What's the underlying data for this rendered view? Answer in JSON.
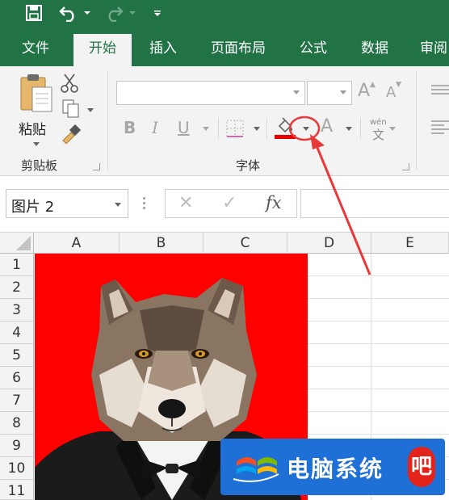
{
  "colors": {
    "brand": "#217346",
    "picture_bg": "#ff0000",
    "watermark_bg": "#1e6fd6",
    "annotation": "#e8393a"
  },
  "quick_access": {
    "icons": [
      "save-icon",
      "undo-icon",
      "undo-dropdown-icon",
      "redo-icon",
      "redo-dropdown-icon",
      "customize-qat-icon"
    ]
  },
  "tabs": [
    {
      "label": "文件"
    },
    {
      "label": "开始",
      "active": true
    },
    {
      "label": "插入"
    },
    {
      "label": "页面布局"
    },
    {
      "label": "公式"
    },
    {
      "label": "数据"
    },
    {
      "label": "审阅"
    }
  ],
  "ribbon": {
    "clipboard": {
      "paste_label": "粘贴",
      "group_label": "剪贴板",
      "icons": [
        "paste-icon",
        "cut-icon",
        "copy-icon",
        "format-painter-icon"
      ]
    },
    "font": {
      "group_label": "字体",
      "font_name_value": "",
      "font_size_value": "",
      "grow_label": "A",
      "shrink_label": "A",
      "bold_label": "B",
      "italic_label": "I",
      "underline_label": "U",
      "font_color_label": "A",
      "phonetic_top": "wén",
      "phonetic_bottom": "文",
      "fill_color": "#e60000"
    }
  },
  "formula_bar": {
    "name_box": "图片 2",
    "cancel_symbol": "✕",
    "enter_symbol": "✓",
    "fx_label": "fx",
    "formula_value": ""
  },
  "grid": {
    "columns": [
      "A",
      "B",
      "C",
      "D",
      "E"
    ],
    "rows": [
      "1",
      "2",
      "3",
      "4",
      "5",
      "6",
      "7",
      "8",
      "9",
      "10",
      "11"
    ]
  },
  "watermark": {
    "text": "电脑系统",
    "badge": "吧"
  }
}
